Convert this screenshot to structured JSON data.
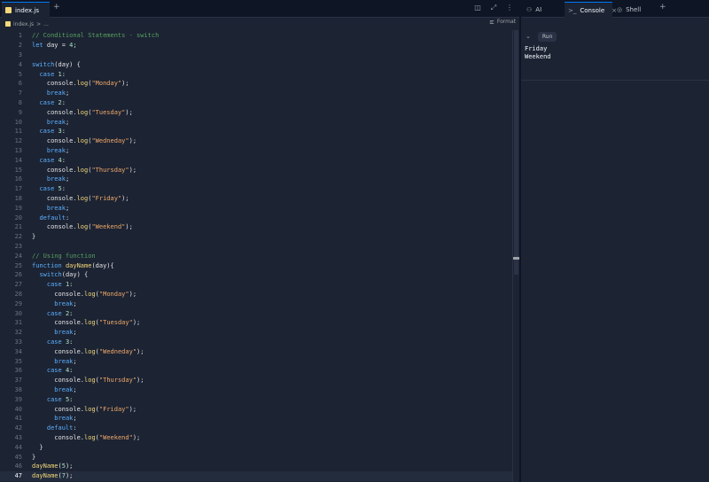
{
  "editor": {
    "tab": {
      "filename": "index.js"
    },
    "tab_add": "+",
    "tools": {
      "split_icon": "◫",
      "expand_icon": "⤢",
      "menu_icon": "⋮"
    },
    "breadcrumb": {
      "file": "index.js",
      "separator": ">",
      "more": "..."
    },
    "format_label": "Format"
  },
  "code_lines": [
    [
      [
        "cm",
        "// Conditional Statements - switch"
      ]
    ],
    [
      [
        "kw",
        "let"
      ],
      [
        "punc",
        " day = "
      ],
      [
        "num",
        "4"
      ],
      [
        "punc",
        ";"
      ]
    ],
    [],
    [
      [
        "kw",
        "switch"
      ],
      [
        "punc",
        "(day) {"
      ]
    ],
    [
      [
        "punc",
        "  "
      ],
      [
        "kw",
        "case"
      ],
      [
        "punc",
        " "
      ],
      [
        "num",
        "1"
      ],
      [
        "punc",
        ":"
      ]
    ],
    [
      [
        "punc",
        "    console."
      ],
      [
        "fn",
        "log"
      ],
      [
        "punc",
        "("
      ],
      [
        "str",
        "\"Monday\""
      ],
      [
        "punc",
        ");"
      ]
    ],
    [
      [
        "punc",
        "    "
      ],
      [
        "kw",
        "break"
      ],
      [
        "punc",
        ";"
      ]
    ],
    [
      [
        "punc",
        "  "
      ],
      [
        "kw",
        "case"
      ],
      [
        "punc",
        " "
      ],
      [
        "num",
        "2"
      ],
      [
        "punc",
        ":"
      ]
    ],
    [
      [
        "punc",
        "    console."
      ],
      [
        "fn",
        "log"
      ],
      [
        "punc",
        "("
      ],
      [
        "str",
        "\"Tuesday\""
      ],
      [
        "punc",
        ");"
      ]
    ],
    [
      [
        "punc",
        "    "
      ],
      [
        "kw",
        "break"
      ],
      [
        "punc",
        ";"
      ]
    ],
    [
      [
        "punc",
        "  "
      ],
      [
        "kw",
        "case"
      ],
      [
        "punc",
        " "
      ],
      [
        "num",
        "3"
      ],
      [
        "punc",
        ":"
      ]
    ],
    [
      [
        "punc",
        "    console."
      ],
      [
        "fn",
        "log"
      ],
      [
        "punc",
        "("
      ],
      [
        "str",
        "\"Wedneday\""
      ],
      [
        "punc",
        ");"
      ]
    ],
    [
      [
        "punc",
        "    "
      ],
      [
        "kw",
        "break"
      ],
      [
        "punc",
        ";"
      ]
    ],
    [
      [
        "punc",
        "  "
      ],
      [
        "kw",
        "case"
      ],
      [
        "punc",
        " "
      ],
      [
        "num",
        "4"
      ],
      [
        "punc",
        ":"
      ]
    ],
    [
      [
        "punc",
        "    console."
      ],
      [
        "fn",
        "log"
      ],
      [
        "punc",
        "("
      ],
      [
        "str",
        "\"Thursday\""
      ],
      [
        "punc",
        ");"
      ]
    ],
    [
      [
        "punc",
        "    "
      ],
      [
        "kw",
        "break"
      ],
      [
        "punc",
        ";"
      ]
    ],
    [
      [
        "punc",
        "  "
      ],
      [
        "kw",
        "case"
      ],
      [
        "punc",
        " "
      ],
      [
        "num",
        "5"
      ],
      [
        "punc",
        ":"
      ]
    ],
    [
      [
        "punc",
        "    console."
      ],
      [
        "fn",
        "log"
      ],
      [
        "punc",
        "("
      ],
      [
        "str",
        "\"Friday\""
      ],
      [
        "punc",
        ");"
      ]
    ],
    [
      [
        "punc",
        "    "
      ],
      [
        "kw",
        "break"
      ],
      [
        "punc",
        ";"
      ]
    ],
    [
      [
        "punc",
        "  "
      ],
      [
        "kw",
        "default"
      ],
      [
        "punc",
        ":"
      ]
    ],
    [
      [
        "punc",
        "    console."
      ],
      [
        "fn",
        "log"
      ],
      [
        "punc",
        "("
      ],
      [
        "str",
        "\"Weekend\""
      ],
      [
        "punc",
        ");"
      ]
    ],
    [
      [
        "punc",
        "}"
      ]
    ],
    [],
    [
      [
        "cm",
        "// Using function"
      ]
    ],
    [
      [
        "kw",
        "function"
      ],
      [
        "punc",
        " "
      ],
      [
        "fn",
        "dayName"
      ],
      [
        "punc",
        "(day){"
      ]
    ],
    [
      [
        "punc",
        "  "
      ],
      [
        "kw",
        "switch"
      ],
      [
        "punc",
        "(day) {"
      ]
    ],
    [
      [
        "punc",
        "    "
      ],
      [
        "kw",
        "case"
      ],
      [
        "punc",
        " "
      ],
      [
        "num",
        "1"
      ],
      [
        "punc",
        ":"
      ]
    ],
    [
      [
        "punc",
        "      console."
      ],
      [
        "fn",
        "log"
      ],
      [
        "punc",
        "("
      ],
      [
        "str",
        "\"Monday\""
      ],
      [
        "punc",
        ");"
      ]
    ],
    [
      [
        "punc",
        "      "
      ],
      [
        "kw",
        "break"
      ],
      [
        "punc",
        ";"
      ]
    ],
    [
      [
        "punc",
        "    "
      ],
      [
        "kw",
        "case"
      ],
      [
        "punc",
        " "
      ],
      [
        "num",
        "2"
      ],
      [
        "punc",
        ":"
      ]
    ],
    [
      [
        "punc",
        "      console."
      ],
      [
        "fn",
        "log"
      ],
      [
        "punc",
        "("
      ],
      [
        "str",
        "\"Tuesday\""
      ],
      [
        "punc",
        ");"
      ]
    ],
    [
      [
        "punc",
        "      "
      ],
      [
        "kw",
        "break"
      ],
      [
        "punc",
        ";"
      ]
    ],
    [
      [
        "punc",
        "    "
      ],
      [
        "kw",
        "case"
      ],
      [
        "punc",
        " "
      ],
      [
        "num",
        "3"
      ],
      [
        "punc",
        ":"
      ]
    ],
    [
      [
        "punc",
        "      console."
      ],
      [
        "fn",
        "log"
      ],
      [
        "punc",
        "("
      ],
      [
        "str",
        "\"Wedneday\""
      ],
      [
        "punc",
        ");"
      ]
    ],
    [
      [
        "punc",
        "      "
      ],
      [
        "kw",
        "break"
      ],
      [
        "punc",
        ";"
      ]
    ],
    [
      [
        "punc",
        "    "
      ],
      [
        "kw",
        "case"
      ],
      [
        "punc",
        " "
      ],
      [
        "num",
        "4"
      ],
      [
        "punc",
        ":"
      ]
    ],
    [
      [
        "punc",
        "      console."
      ],
      [
        "fn",
        "log"
      ],
      [
        "punc",
        "("
      ],
      [
        "str",
        "\"Thursday\""
      ],
      [
        "punc",
        ");"
      ]
    ],
    [
      [
        "punc",
        "      "
      ],
      [
        "kw",
        "break"
      ],
      [
        "punc",
        ";"
      ]
    ],
    [
      [
        "punc",
        "    "
      ],
      [
        "kw",
        "case"
      ],
      [
        "punc",
        " "
      ],
      [
        "num",
        "5"
      ],
      [
        "punc",
        ":"
      ]
    ],
    [
      [
        "punc",
        "      console."
      ],
      [
        "fn",
        "log"
      ],
      [
        "punc",
        "("
      ],
      [
        "str",
        "\"Friday\""
      ],
      [
        "punc",
        ");"
      ]
    ],
    [
      [
        "punc",
        "      "
      ],
      [
        "kw",
        "break"
      ],
      [
        "punc",
        ";"
      ]
    ],
    [
      [
        "punc",
        "    "
      ],
      [
        "kw",
        "default"
      ],
      [
        "punc",
        ":"
      ]
    ],
    [
      [
        "punc",
        "      console."
      ],
      [
        "fn",
        "log"
      ],
      [
        "punc",
        "("
      ],
      [
        "str",
        "\"Weekend\""
      ],
      [
        "punc",
        ");"
      ]
    ],
    [
      [
        "punc",
        "  }"
      ]
    ],
    [
      [
        "punc",
        "}"
      ]
    ],
    [
      [
        "fn",
        "dayName"
      ],
      [
        "punc",
        "("
      ],
      [
        "num",
        "5"
      ],
      [
        "punc",
        ");"
      ]
    ],
    [
      [
        "fn",
        "dayName"
      ],
      [
        "punc",
        "("
      ],
      [
        "num",
        "7"
      ],
      [
        "punc",
        ");"
      ]
    ]
  ],
  "active_line": 47,
  "right_panel": {
    "tabs": [
      {
        "icon": "ai-icon",
        "glyph": "⚇",
        "label": "AI",
        "active": false
      },
      {
        "icon": "console-icon",
        "glyph": ">_",
        "label": "Console",
        "active": true,
        "close": "×"
      },
      {
        "icon": "shell-icon",
        "glyph": "◎",
        "label": "Shell",
        "active": false
      }
    ],
    "add": "+",
    "console": {
      "chevron": "⌄",
      "run_label": "Run",
      "output": [
        "Friday",
        "Weekend"
      ]
    }
  },
  "colors": {
    "background": "#1c2333",
    "tabbar": "#0e1525",
    "accent": "#0079f2",
    "keyword": "#5bb0ff",
    "function": "#f5d97a",
    "string": "#f0a96a",
    "number": "#a9e5c5",
    "comment": "#56a05e"
  }
}
